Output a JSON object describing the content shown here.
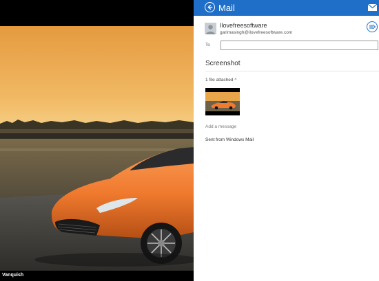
{
  "photo": {
    "caption": "Vanquish",
    "subject": "orange sports car at sunset"
  },
  "mail": {
    "title": "Mail",
    "sender_name": "Ilovefreesoftware",
    "sender_email": "garimasingh@ilovefreesoftware.com",
    "to_label": "To",
    "to_value": "",
    "subject": "Screenshot",
    "attachment_label": "1 file attached",
    "add_message_placeholder": "Add a message",
    "signature": "Sent from Windows Mail"
  },
  "colors": {
    "accent": "#1f6fc9",
    "car": "#f07a2e",
    "sky_top": "#e9a54a",
    "sky_bottom": "#f2c270"
  }
}
